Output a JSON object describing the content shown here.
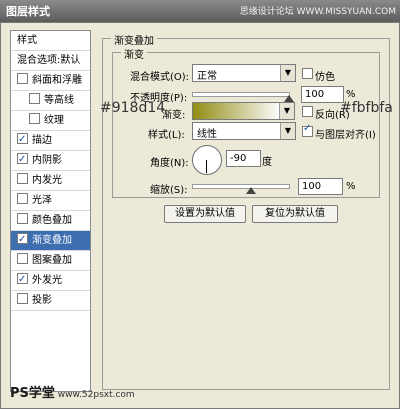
{
  "window": {
    "title": "图层样式",
    "watermark": "思缘设计论坛 WWW.MISSYUAN.COM"
  },
  "styles_list": {
    "header": "样式",
    "blend_options": "混合选项:默认",
    "items": [
      {
        "label": "斜面和浮雕",
        "checked": false,
        "indent": false,
        "selected": false
      },
      {
        "label": "等高线",
        "checked": false,
        "indent": true,
        "selected": false
      },
      {
        "label": "纹理",
        "checked": false,
        "indent": true,
        "selected": false
      },
      {
        "label": "描边",
        "checked": true,
        "indent": false,
        "selected": false
      },
      {
        "label": "内阴影",
        "checked": true,
        "indent": false,
        "selected": false
      },
      {
        "label": "内发光",
        "checked": false,
        "indent": false,
        "selected": false
      },
      {
        "label": "光泽",
        "checked": false,
        "indent": false,
        "selected": false
      },
      {
        "label": "颜色叠加",
        "checked": false,
        "indent": false,
        "selected": false
      },
      {
        "label": "渐变叠加",
        "checked": true,
        "indent": false,
        "selected": true
      },
      {
        "label": "图案叠加",
        "checked": false,
        "indent": false,
        "selected": false
      },
      {
        "label": "外发光",
        "checked": true,
        "indent": false,
        "selected": false
      },
      {
        "label": "投影",
        "checked": false,
        "indent": false,
        "selected": false
      }
    ]
  },
  "panel": {
    "title": "渐变叠加",
    "subtitle": "渐变",
    "blend_mode_label": "混合模式(O):",
    "blend_mode_value": "正常",
    "dither_label": "仿色",
    "opacity_label": "不透明度(P):",
    "opacity_value": "100",
    "opacity_unit": "%",
    "gradient_label": "渐变:",
    "reverse_label": "反向(R)",
    "style_label": "样式(L):",
    "style_value": "线性",
    "align_label": "与图层对齐(I)",
    "angle_label": "角度(N):",
    "angle_value": "-90",
    "angle_unit": "度",
    "scale_label": "缩放(S):",
    "scale_value": "100",
    "scale_unit": "%",
    "reset_default_button": "设置为默认值",
    "restore_default_button": "复位为默认值"
  },
  "annotations": {
    "left_color": "#918d14",
    "right_color": "#fbfbfa"
  },
  "colors": {
    "gradient_start": "#918d14",
    "gradient_end": "#fbfbfa",
    "selected_bg": "#3d6fb0"
  },
  "footer": {
    "logo_text": "PS学堂",
    "site": "www.52psxt.com"
  }
}
